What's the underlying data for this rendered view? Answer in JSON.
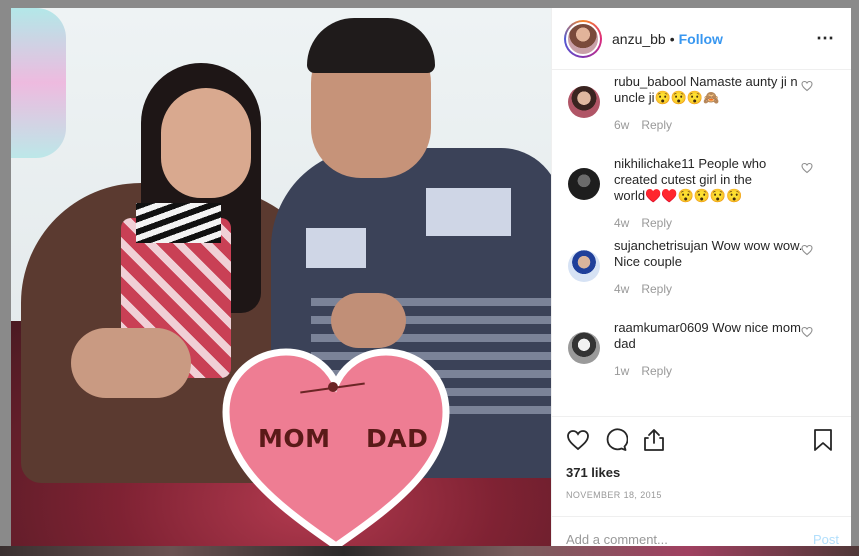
{
  "photo": {
    "heart_left": "MOM",
    "heart_right": "DAD",
    "colors": {
      "heart": "#ee7d93",
      "heart_border": "#ffffff"
    }
  },
  "header": {
    "username": "anzu_bb",
    "separator": "•",
    "follow_label": "Follow",
    "more_icon": "ellipsis-icon"
  },
  "comments": [
    {
      "user": "rubu_babool",
      "text": "Namaste aunty ji n uncle ji😯😯😯🙈",
      "time": "6w",
      "reply": "Reply",
      "avatar_color": "#8a4050"
    },
    {
      "user": "nikhilichake11",
      "text": "People who created cutest girl in the world♥️♥️😯😯😯😯",
      "time": "4w",
      "reply": "Reply",
      "avatar_color": "#2f2f2f"
    },
    {
      "user": "sujanchetrisujan",
      "text": "Wow wow wow. Nice couple",
      "time": "4w",
      "reply": "Reply",
      "avatar_color": "#3a6fc4"
    },
    {
      "user": "raamkumar0609",
      "text": "Wow nice mom dad",
      "time": "1w",
      "reply": "Reply",
      "avatar_color": "#555555"
    }
  ],
  "actions": {
    "icons": [
      "heart-outline-icon",
      "comment-icon",
      "share-icon",
      "bookmark-icon"
    ],
    "likes": "371 likes",
    "date": "NOVEMBER 18, 2015"
  },
  "composer": {
    "placeholder": "Add a comment...",
    "post_label": "Post"
  },
  "colors": {
    "link": "#3897f0",
    "muted": "#999999",
    "text": "#262626"
  }
}
